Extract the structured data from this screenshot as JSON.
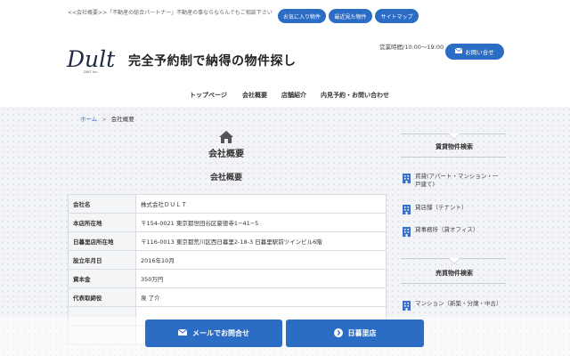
{
  "header": {
    "tagline": "<<会社概要>>「不動産の総合パートナー」不動産の事ならならんでもご相談下さい",
    "top_links": [
      "お気に入り物件",
      "最近見た物件",
      "サイトマップ"
    ],
    "logo_text": "Dult",
    "logo_sub": "DULT Inc.",
    "site_title": "完全予約制で納得の物件探し",
    "hours": "営業時間/10:00～19:00",
    "contact_label": "お問い合せ"
  },
  "nav": {
    "items": [
      "トップページ",
      "会社概要",
      "店舗紹介",
      "内見予約・お問い合わせ"
    ]
  },
  "breadcrumb": {
    "home": "ホーム",
    "separator": ">",
    "current": "会社概要"
  },
  "main": {
    "page_title": "会社概要",
    "section_title": "会社概要",
    "rows": [
      {
        "label": "会社名",
        "value": "株式会社ＤＵＬＴ"
      },
      {
        "label": "本店所在地",
        "value": "〒154-0021 東京都世田谷区豪徳寺1−41−5"
      },
      {
        "label": "日暮里店所在地",
        "value": "〒116-0013 東京都荒川区西日暮里2-18-3 日暮里駅前ツインビル6階"
      },
      {
        "label": "設立年月日",
        "value": "2016年10月"
      },
      {
        "label": "資本金",
        "value": "350万円"
      },
      {
        "label": "代表取締役",
        "value": "泉 了介"
      }
    ]
  },
  "sidebar": {
    "rent_title": "賃貸物件検索",
    "rent_items": [
      "賃貸(アパート・マンション・一戸建て)",
      "貸店舗（テナント）",
      "貸事務所（貸オフィス）"
    ],
    "sale_title": "売買物件検索",
    "sale_items": [
      "マンション（新築・分譲・中古）"
    ]
  },
  "bottom": {
    "mail_label": "メールでお問合せ",
    "store_label": "日暮里店"
  },
  "colors": {
    "accent": "#2b6cc4",
    "icon_blue": "#3a72c8"
  }
}
